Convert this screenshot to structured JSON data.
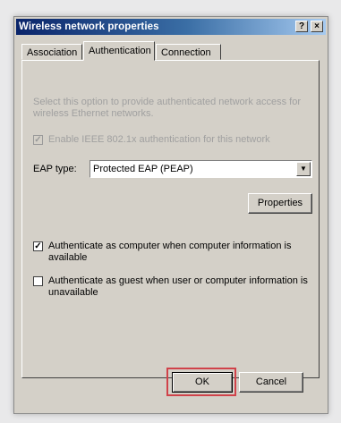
{
  "window": {
    "title": "Wireless network properties",
    "help_button": "?",
    "close_button": "×"
  },
  "tabs": [
    {
      "label": "Association",
      "active": false
    },
    {
      "label": "Authentication",
      "active": true
    },
    {
      "label": "Connection",
      "active": false
    }
  ],
  "panel": {
    "intro_text": "Select this option to provide authenticated network access for wireless Ethernet networks.",
    "enable_8021x": {
      "label": "Enable IEEE 802.1x authentication for this network",
      "checked": true,
      "enabled": false
    },
    "eap_type": {
      "label": "EAP type:",
      "value": "Protected EAP (PEAP)"
    },
    "properties_button": "Properties",
    "auth_as_computer": {
      "label": "Authenticate as computer when computer information is available",
      "checked": true
    },
    "auth_as_guest": {
      "label": "Authenticate as guest when user or computer information is unavailable",
      "checked": false
    }
  },
  "footer": {
    "ok_button": "OK",
    "cancel_button": "Cancel",
    "highlight_color": "#d0424a"
  },
  "check_mark": "✓"
}
